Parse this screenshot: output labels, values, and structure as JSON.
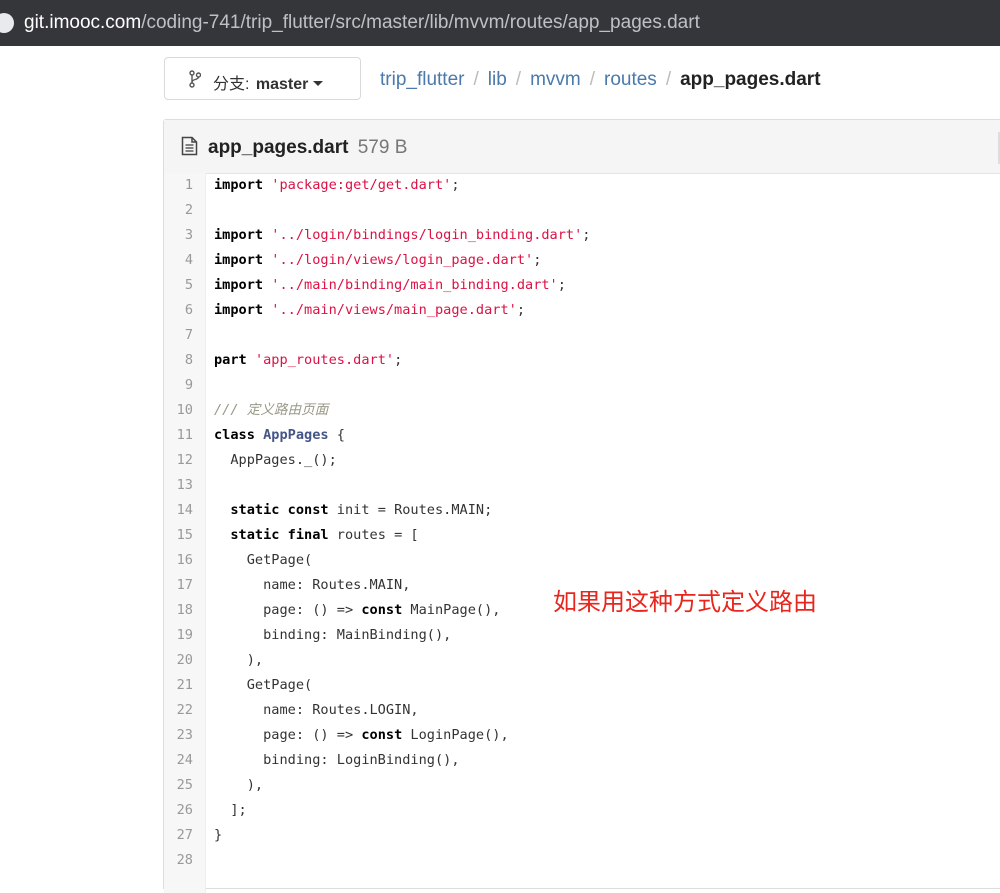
{
  "browser": {
    "url_host": "git.imooc.com",
    "url_path": "/coding-741/trip_flutter/src/master/lib/mvvm/routes/app_pages.dart"
  },
  "branch": {
    "label": "分支:",
    "name": "master"
  },
  "breadcrumb": {
    "links": [
      "trip_flutter",
      "lib",
      "mvvm",
      "routes"
    ],
    "separator": "/",
    "current": "app_pages.dart"
  },
  "file": {
    "name": "app_pages.dart",
    "size": "579 B"
  },
  "code_lines": [
    [
      [
        "kw",
        "import"
      ],
      [
        "p",
        " "
      ],
      [
        "str",
        "'package:get/get.dart'"
      ],
      [
        "p",
        ";"
      ]
    ],
    [],
    [
      [
        "kw",
        "import"
      ],
      [
        "p",
        " "
      ],
      [
        "str",
        "'../login/bindings/login_binding.dart'"
      ],
      [
        "p",
        ";"
      ]
    ],
    [
      [
        "kw",
        "import"
      ],
      [
        "p",
        " "
      ],
      [
        "str",
        "'../login/views/login_page.dart'"
      ],
      [
        "p",
        ";"
      ]
    ],
    [
      [
        "kw",
        "import"
      ],
      [
        "p",
        " "
      ],
      [
        "str",
        "'../main/binding/main_binding.dart'"
      ],
      [
        "p",
        ";"
      ]
    ],
    [
      [
        "kw",
        "import"
      ],
      [
        "p",
        " "
      ],
      [
        "str",
        "'../main/views/main_page.dart'"
      ],
      [
        "p",
        ";"
      ]
    ],
    [],
    [
      [
        "kw",
        "part"
      ],
      [
        "p",
        " "
      ],
      [
        "str",
        "'app_routes.dart'"
      ],
      [
        "p",
        ";"
      ]
    ],
    [],
    [
      [
        "cmt",
        "/// 定义路由页面"
      ]
    ],
    [
      [
        "kw",
        "class"
      ],
      [
        "p",
        " "
      ],
      [
        "cls",
        "AppPages"
      ],
      [
        "p",
        " {"
      ]
    ],
    [
      [
        "p",
        "  AppPages._();"
      ]
    ],
    [],
    [
      [
        "p",
        "  "
      ],
      [
        "kw",
        "static"
      ],
      [
        "p",
        " "
      ],
      [
        "kw",
        "const"
      ],
      [
        "p",
        " init = Routes.MAIN;"
      ]
    ],
    [
      [
        "p",
        "  "
      ],
      [
        "kw",
        "static"
      ],
      [
        "p",
        " "
      ],
      [
        "kw",
        "final"
      ],
      [
        "p",
        " routes = ["
      ]
    ],
    [
      [
        "p",
        "    GetPage("
      ]
    ],
    [
      [
        "p",
        "      name: Routes.MAIN,"
      ]
    ],
    [
      [
        "p",
        "      page: () => "
      ],
      [
        "kw",
        "const"
      ],
      [
        "p",
        " MainPage(),"
      ]
    ],
    [
      [
        "p",
        "      binding: MainBinding(),"
      ]
    ],
    [
      [
        "p",
        "    ),"
      ]
    ],
    [
      [
        "p",
        "    GetPage("
      ]
    ],
    [
      [
        "p",
        "      name: Routes.LOGIN,"
      ]
    ],
    [
      [
        "p",
        "      page: () => "
      ],
      [
        "kw",
        "const"
      ],
      [
        "p",
        " LoginPage(),"
      ]
    ],
    [
      [
        "p",
        "      binding: LoginBinding(),"
      ]
    ],
    [
      [
        "p",
        "    ),"
      ]
    ],
    [
      [
        "p",
        "  ];"
      ]
    ],
    [
      [
        "p",
        "}"
      ]
    ],
    []
  ],
  "annotation": "如果用这种方式定义路由"
}
